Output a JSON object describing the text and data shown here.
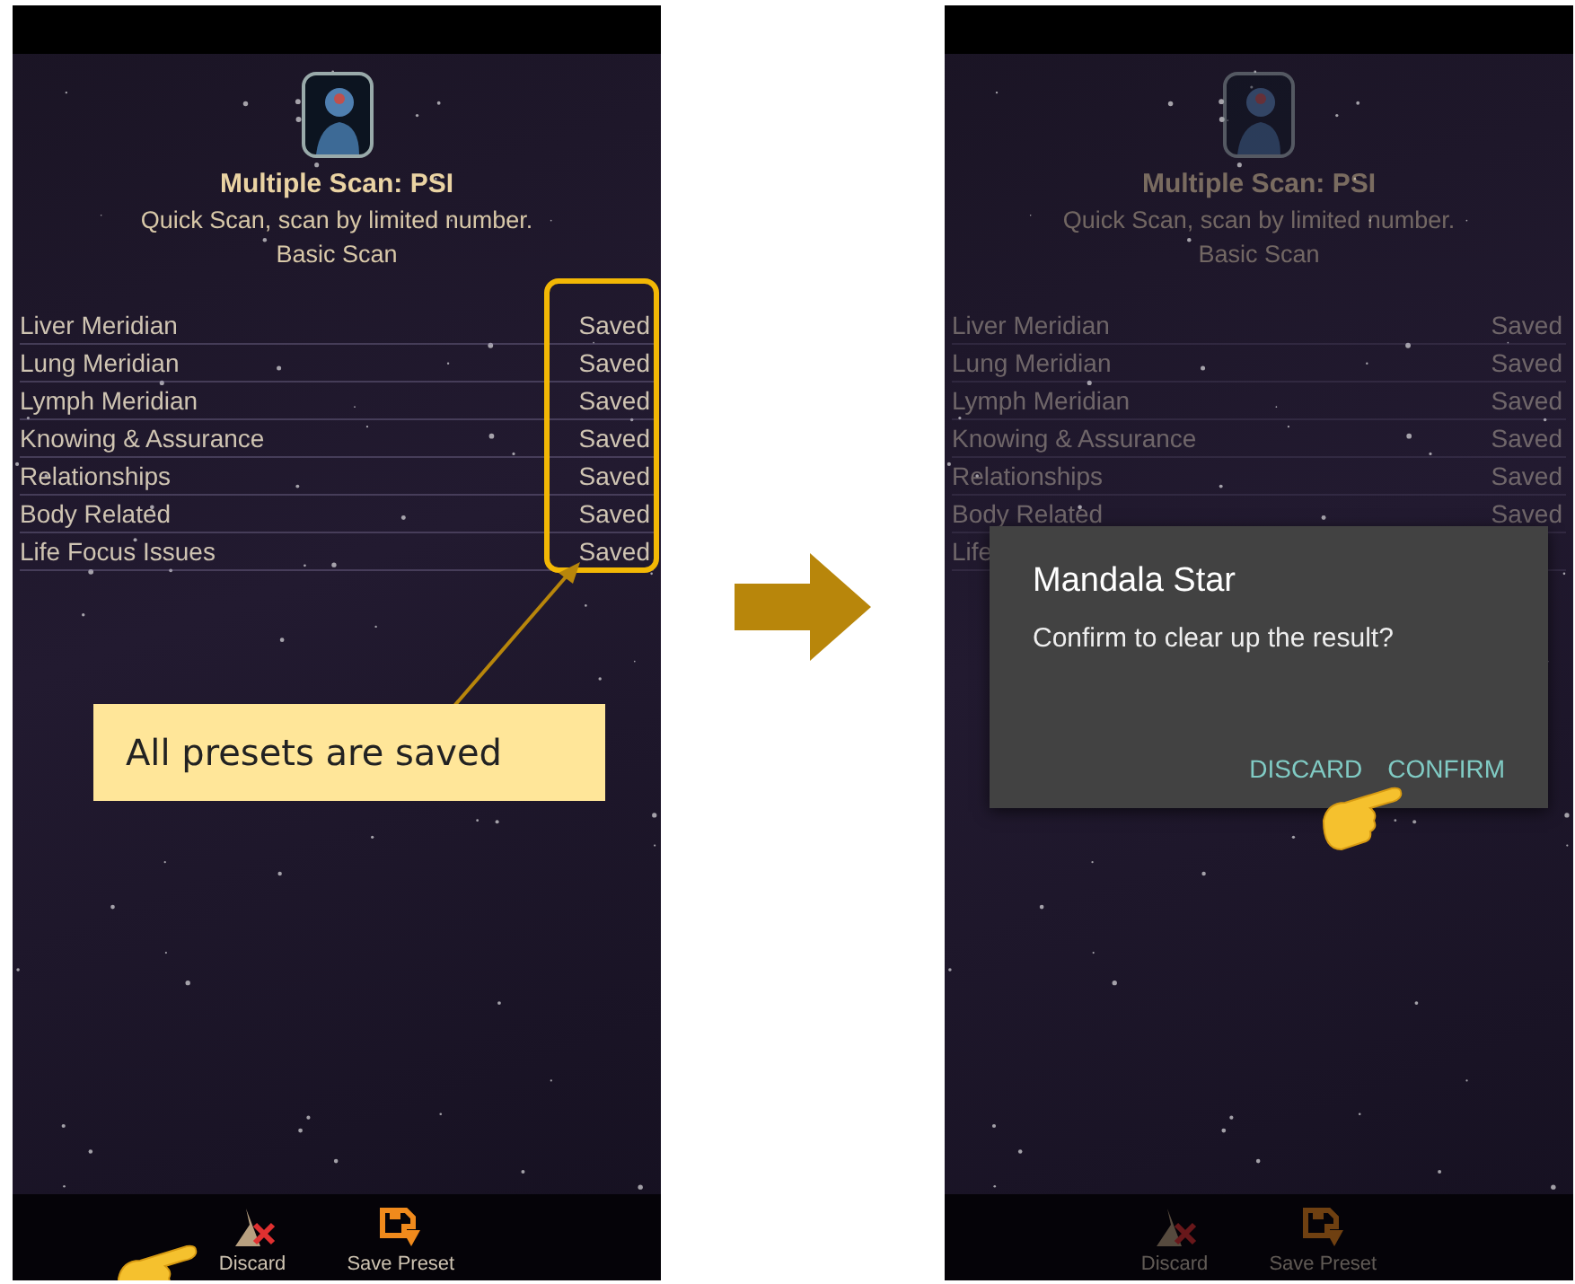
{
  "screens": [
    {
      "dimmed": false,
      "title": "Multiple Scan: PSI",
      "subtitle": "Quick Scan, scan by limited number.",
      "mode": "Basic Scan",
      "rows": [
        {
          "name": "Liver Meridian",
          "status": "Saved"
        },
        {
          "name": "Lung Meridian",
          "status": "Saved"
        },
        {
          "name": "Lymph Meridian",
          "status": "Saved"
        },
        {
          "name": "Knowing & Assurance",
          "status": "Saved"
        },
        {
          "name": "Relationships",
          "status": "Saved"
        },
        {
          "name": "Body Related",
          "status": "Saved"
        },
        {
          "name": "Life Focus Issues",
          "status": "Saved"
        }
      ],
      "toolbar": [
        {
          "kind": "discard",
          "label": "Discard",
          "pointed": true
        },
        {
          "kind": "save",
          "label": "Save Preset",
          "pointed": false
        }
      ],
      "callout": "All presets are saved"
    },
    {
      "dimmed": true,
      "title": "Multiple Scan: PSI",
      "subtitle": "Quick Scan, scan by limited number.",
      "mode": "Basic Scan",
      "rows": [
        {
          "name": "Liver Meridian",
          "status": "Saved"
        },
        {
          "name": "Lung Meridian",
          "status": "Saved"
        },
        {
          "name": "Lymph Meridian",
          "status": "Saved"
        },
        {
          "name": "Knowing & Assurance",
          "status": "Saved"
        },
        {
          "name": "Relationships",
          "status": "Saved"
        },
        {
          "name": "Body Related",
          "status": "Saved"
        },
        {
          "name": "Life"
        }
      ],
      "toolbar": [
        {
          "kind": "discard",
          "label": "Discard",
          "pointed": false
        },
        {
          "kind": "save",
          "label": "Save Preset",
          "pointed": false
        }
      ],
      "dialog": {
        "title": "Mandala Star",
        "message": "Confirm to clear up the result?",
        "buttons": [
          {
            "label": "DISCARD",
            "pointed": false
          },
          {
            "label": "CONFIRM",
            "pointed": true
          }
        ]
      }
    }
  ]
}
